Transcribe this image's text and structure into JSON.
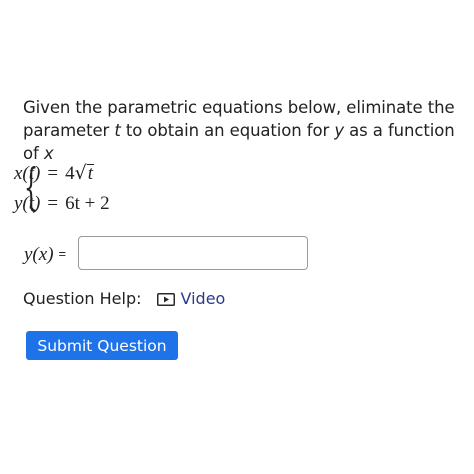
{
  "question": {
    "prompt_before_t": "Given the parametric equations below, eliminate the parameter ",
    "param_var": "t",
    "prompt_middle": " to obtain an equation for ",
    "dependent_var": "y",
    "prompt_after": " as a function of ",
    "independent_var": "x"
  },
  "system": {
    "eq1_lhs": "x(t)",
    "eq1_rel": "=",
    "eq1_coef": "4",
    "eq1_radicand": "t",
    "eq2_lhs": "y(t)",
    "eq2_rel": "=",
    "eq2_rhs": "6t + 2"
  },
  "answer": {
    "label": "y(x)",
    "equals": "=",
    "value": "",
    "placeholder": ""
  },
  "help": {
    "label": "Question Help:",
    "video_label": "Video",
    "video_icon": "play-video-icon"
  },
  "submit": {
    "label": "Submit Question",
    "color": "#1e73e8"
  }
}
